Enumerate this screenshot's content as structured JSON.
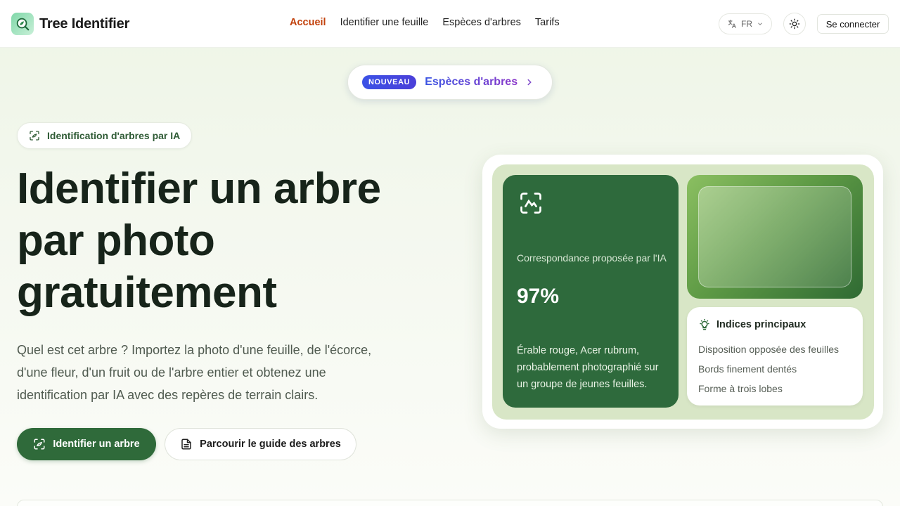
{
  "brand": {
    "name": "Tree Identifier"
  },
  "nav": {
    "items": [
      {
        "label": "Accueil",
        "active": true
      },
      {
        "label": "Identifier une feuille",
        "active": false
      },
      {
        "label": "Espèces d'arbres",
        "active": false
      },
      {
        "label": "Tarifs",
        "active": false
      }
    ]
  },
  "header": {
    "lang_label": "FR",
    "login_label": "Se connecter"
  },
  "announcement": {
    "badge": "NOUVEAU",
    "label": "Espèces d'arbres"
  },
  "hero": {
    "tag": "Identification d'arbres par IA",
    "title": "Identifier un arbre par photo gratuitement",
    "description": "Quel est cet arbre ? Importez la photo d'une feuille, de l'écorce, d'une fleur, d'un fruit ou de l'arbre entier et obtenez une identification par IA avec des repères de terrain clairs.",
    "primary_cta": "Identifier un arbre",
    "secondary_cta": "Parcourir le guide des arbres"
  },
  "result_card": {
    "match_caption": "Correspondance proposée par l'IA",
    "match_value": "97%",
    "match_description": "Érable rouge, Acer rubrum, probablement photographié sur un groupe de jeunes feuilles.",
    "hints_title": "Indices principaux",
    "hints": [
      "Disposition opposée des feuilles",
      "Bords finement dentés",
      "Forme à trois lobes"
    ]
  },
  "colors": {
    "accent_green": "#2f6a3a",
    "active_nav": "#c2410c",
    "badge_blue": "#3b52e6",
    "announce_purple": "#8a35c9"
  },
  "icons": {
    "brand": "magnifier-leaf-icon",
    "lang": "translate-icon",
    "theme": "sun-icon",
    "tag": "scan-icon",
    "announce": "chevron-right-icon",
    "primary_cta": "scan-icon",
    "secondary_cta": "document-icon",
    "hints": "lightbulb-icon"
  }
}
